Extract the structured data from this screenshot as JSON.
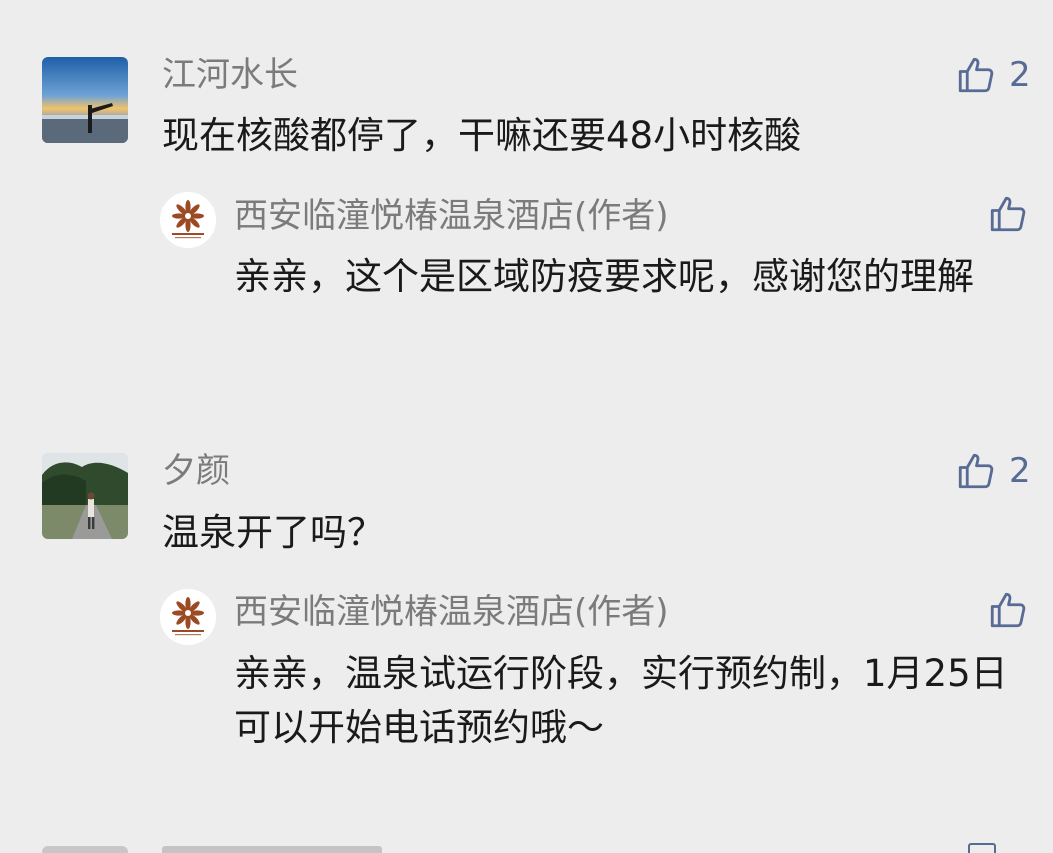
{
  "comments": [
    {
      "user": "江河水长",
      "text": "现在核酸都停了，干嘛还要48小时核酸",
      "likes": "2",
      "avatar_icon": "beach-sunset-avatar",
      "reply": {
        "user": "西安临潼悦椿温泉酒店(作者)",
        "text": "亲亲，这个是区域防疫要求呢，感谢您的理解",
        "avatar_icon": "angsana-logo-avatar"
      }
    },
    {
      "user": "夕颜",
      "text": "温泉开了吗？",
      "likes": "2",
      "avatar_icon": "running-girl-avatar",
      "reply": {
        "user": "西安临潼悦椿温泉酒店(作者)",
        "text": "亲亲，温泉试运行阶段，实行预约制，1月25日可以开始电话预约哦～",
        "avatar_icon": "angsana-logo-avatar"
      }
    }
  ],
  "colors": {
    "background": "#ededed",
    "name_gray": "#7b7b7b",
    "text": "#1a1a1a",
    "like_blue": "#576b95",
    "logo_brown": "#9c4a24"
  }
}
